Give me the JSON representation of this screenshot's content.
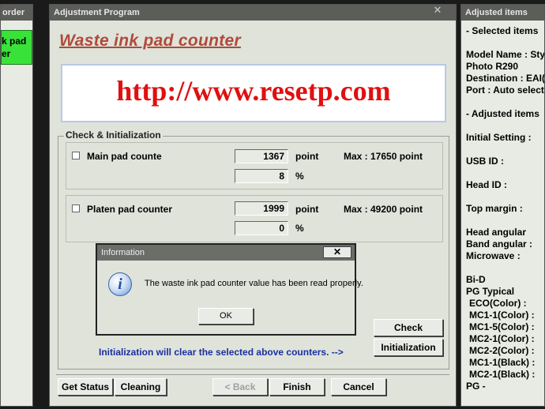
{
  "left_window": {
    "title": "order",
    "green_button_line1": "k pad",
    "green_button_line2": "er"
  },
  "main_window": {
    "title": "Adjustment Program",
    "close": "✕",
    "heading": "Waste ink pad counter",
    "banner_url": "http://www.resetp.com",
    "group_title": "Check & Initialization",
    "rows": [
      {
        "label": "Main pad counte",
        "value": "1367",
        "unit": "point",
        "max": "Max : 17650 point",
        "percent": "8",
        "percent_unit": "%"
      },
      {
        "label": "Platen pad counter",
        "value": "1999",
        "unit": "point",
        "max": "Max : 49200 point",
        "percent": "0",
        "percent_unit": "%"
      }
    ],
    "check_button": "Check",
    "init_note": "Initialization will clear the selected above counters. -->",
    "init_button": "Initialization",
    "bottom_buttons": {
      "get_status": "Get Status",
      "cleaning": "Cleaning",
      "back": "< Back",
      "finish": "Finish",
      "cancel": "Cancel"
    }
  },
  "dialog": {
    "title": "Information",
    "close": "✕",
    "icon": "info-icon",
    "message": "The waste ink pad counter value has been read properly.",
    "ok": "OK"
  },
  "right_window": {
    "title": "Adjusted items",
    "lines": [
      "- Selected items",
      "",
      "Model Name : Sty",
      "Photo R290",
      "Destination : EAI(",
      "Port : Auto select",
      "",
      "- Adjusted items",
      "",
      "Initial Setting :",
      "",
      "USB ID :",
      "",
      "Head ID :",
      "",
      "Top margin :",
      "",
      "Head angular",
      "Band angular :",
      "Microwave :",
      "",
      "Bi-D",
      "PG Typical",
      " ECO(Color)  :",
      " MC1-1(Color) :",
      " MC1-5(Color) :",
      " MC2-1(Color) :",
      " MC2-2(Color) :",
      " MC1-1(Black) :",
      " MC2-1(Black) :",
      "PG -"
    ]
  }
}
